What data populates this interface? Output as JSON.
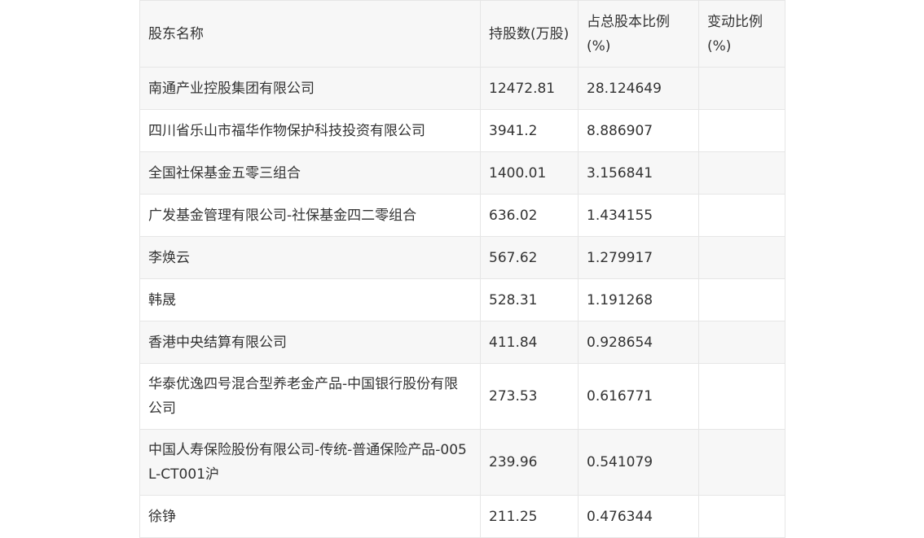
{
  "table": {
    "headers": [
      "股东名称",
      "持股数(万股)",
      "占总股本比例(%)",
      "变动比例(%)"
    ],
    "rows": [
      {
        "name": "南通产业控股集团有限公司",
        "shares": "12472.81",
        "ratio": "28.124649",
        "change": ""
      },
      {
        "name": "四川省乐山市福华作物保护科技投资有限公司",
        "shares": "3941.2",
        "ratio": "8.886907",
        "change": ""
      },
      {
        "name": "全国社保基金五零三组合",
        "shares": "1400.01",
        "ratio": "3.156841",
        "change": ""
      },
      {
        "name": "广发基金管理有限公司-社保基金四二零组合",
        "shares": "636.02",
        "ratio": "1.434155",
        "change": ""
      },
      {
        "name": "李焕云",
        "shares": "567.62",
        "ratio": "1.279917",
        "change": ""
      },
      {
        "name": "韩晟",
        "shares": "528.31",
        "ratio": "1.191268",
        "change": ""
      },
      {
        "name": "香港中央结算有限公司",
        "shares": "411.84",
        "ratio": "0.928654",
        "change": ""
      },
      {
        "name": "华泰优逸四号混合型养老金产品-中国银行股份有限公司",
        "shares": "273.53",
        "ratio": "0.616771",
        "change": ""
      },
      {
        "name": "中国人寿保险股份有限公司-传统-普通保险产品-005L-CT001沪",
        "shares": "239.96",
        "ratio": "0.541079",
        "change": ""
      },
      {
        "name": "徐铮",
        "shares": "211.25",
        "ratio": "0.476344",
        "change": ""
      }
    ]
  }
}
